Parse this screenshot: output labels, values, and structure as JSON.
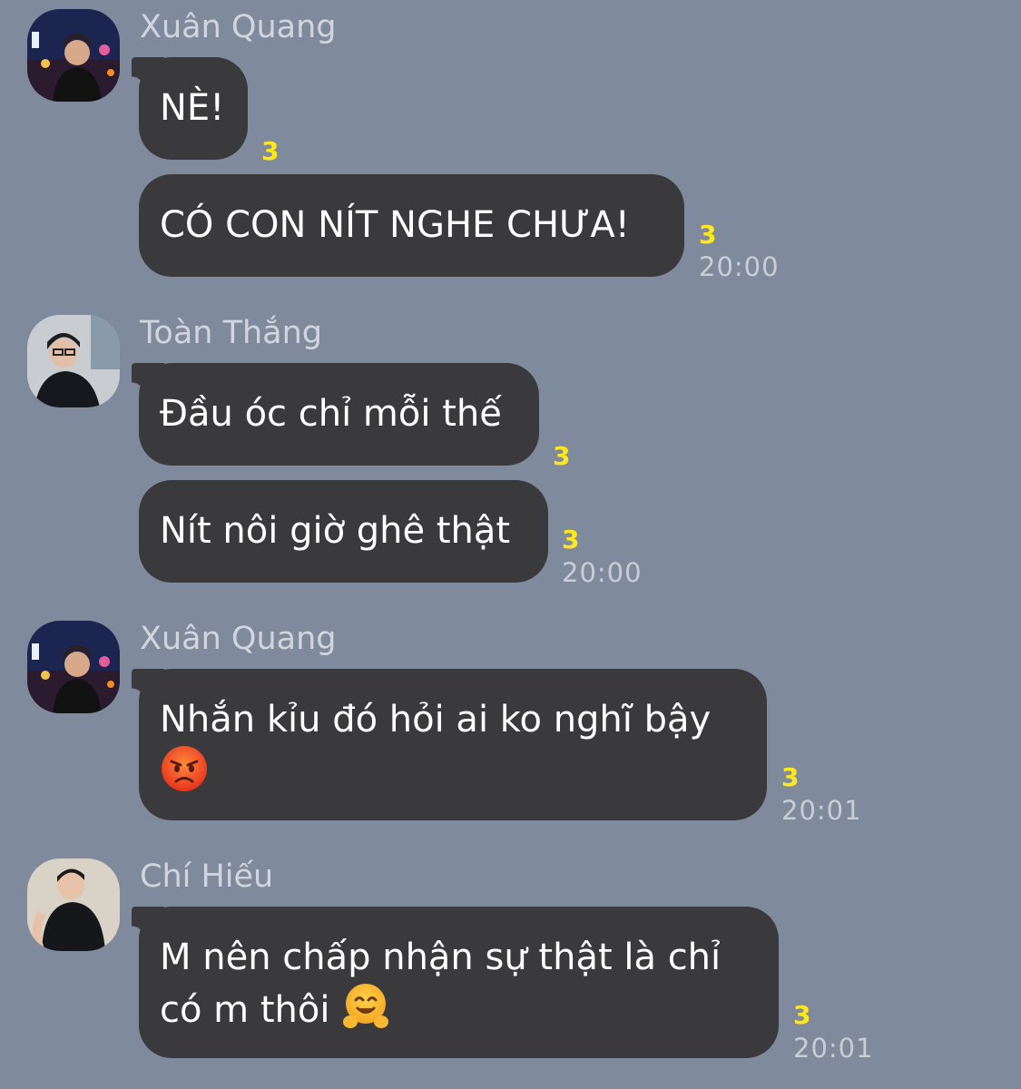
{
  "messages": [
    {
      "sender": "Xuân Quang",
      "bubbles": [
        {
          "text": "NÈ!",
          "read": "3"
        },
        {
          "text": "CÓ CON NÍT NGHE CHƯA!",
          "read": "3",
          "time": "20:00"
        }
      ]
    },
    {
      "sender": "Toàn Thắng",
      "bubbles": [
        {
          "text": "Đầu óc chỉ mỗi thế",
          "read": "3"
        },
        {
          "text": "Nít nôi giờ ghê thật",
          "read": "3",
          "time": "20:00"
        }
      ]
    },
    {
      "sender": "Xuân Quang",
      "bubbles": [
        {
          "text_line1": "Nhắn kỉu đó hỏi ai ko nghĩ bậy",
          "emoji": "pouting-face-emoji",
          "read": "3",
          "time": "20:01"
        }
      ]
    },
    {
      "sender": "Chí Hiếu",
      "bubbles": [
        {
          "text_line1": "M nên chấp nhận sự thật là chỉ",
          "text_line2": "có m thôi",
          "emoji": "hugging-face-emoji",
          "read": "3",
          "time": "20:01"
        }
      ]
    }
  ],
  "colors": {
    "background": "#808a9d",
    "bubble": "#3a3a3c",
    "read_count": "#ffe81a",
    "time": "#c9cdd6"
  }
}
